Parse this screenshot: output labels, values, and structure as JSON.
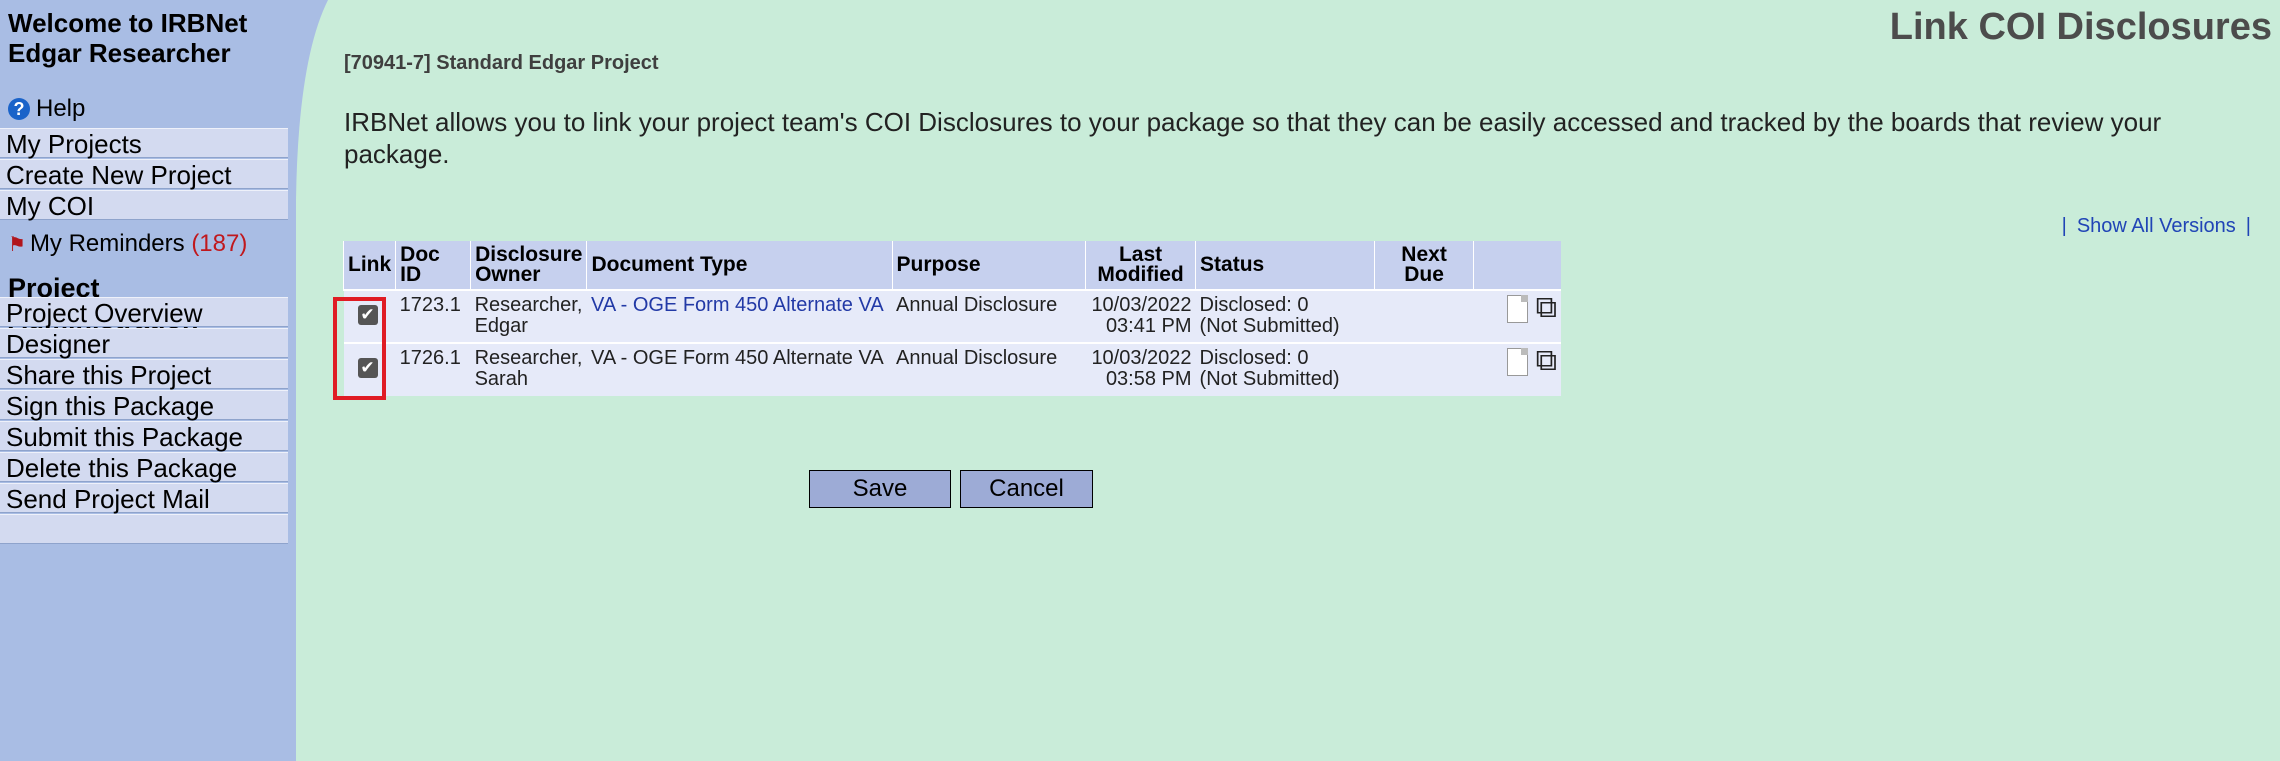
{
  "sidebar": {
    "welcome": "Welcome to IRBNet Edgar Researcher",
    "help": "Help",
    "top_items": [
      "My Projects",
      "Create New Project",
      "My COI"
    ],
    "reminders_label": "My Reminders",
    "reminders_count": "(187)",
    "section_title": "Project Administration",
    "admin_items": [
      "Project Overview",
      "Designer",
      "Share this Project",
      "Sign this Package",
      "Submit this Package",
      "Delete this Package",
      "Send Project Mail"
    ]
  },
  "page": {
    "title": "Link COI Disclosures",
    "project": "[70941-7] Standard Edgar Project",
    "intro": "IRBNet allows you to link your project team's COI Disclosures to your package so that they can be easily accessed and tracked by the boards that review your package.",
    "show_versions": "Show All Versions",
    "separator": "|"
  },
  "table": {
    "headers": {
      "link": "Link",
      "doc_id": "Doc ID",
      "owner_1": "Disclosure",
      "owner_2": "Owner",
      "doc_type": "Document Type",
      "purpose": "Purpose",
      "modified_1": "Last",
      "modified_2": "Modified",
      "status": "Status",
      "due_1": "Next",
      "due_2": "Due"
    },
    "rows": [
      {
        "doc_id": "1723.1",
        "owner_1": "Researcher,",
        "owner_2": "Edgar",
        "doc_type": "VA - OGE Form 450 Alternate VA",
        "purpose": "Annual Disclosure",
        "date": "10/03/2022",
        "time": "03:41 PM",
        "status_1": "Disclosed: 0",
        "status_2": "(Not Submitted)",
        "checked": true
      },
      {
        "doc_id": "1726.1",
        "owner_1": "Researcher,",
        "owner_2": "Sarah",
        "doc_type": "VA - OGE Form 450 Alternate VA",
        "purpose": "Annual Disclosure",
        "date": "10/03/2022",
        "time": "03:58 PM",
        "status_1": "Disclosed: 0",
        "status_2": "(Not Submitted)",
        "checked": true
      }
    ]
  },
  "buttons": {
    "save": "Save",
    "cancel": "Cancel"
  },
  "colors": {
    "highlight": "#e01c24",
    "background": "#c9ecd9",
    "sidebar": "#a9bde4",
    "link": "#2239a6"
  }
}
